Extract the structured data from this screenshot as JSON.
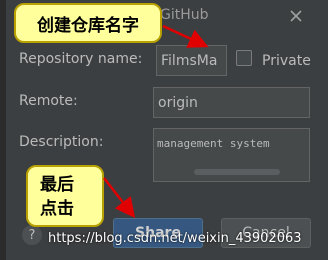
{
  "dialog": {
    "title": "GitHub"
  },
  "form": {
    "repository_label": "Repository name:",
    "repository_value": "FilmsMa",
    "private_label": "Private",
    "remote_label": "Remote:",
    "remote_value": "origin",
    "description_label": "Description:",
    "description_value": "management system"
  },
  "buttons": {
    "help": "?",
    "share": "Share",
    "cancel": "Cancel"
  },
  "annotations": {
    "callout_1": "创建仓库名字",
    "callout_2_line_1": "最后",
    "callout_2_line_2": "点击"
  },
  "watermark": "https://blog.csdn.net/weixin_43902063",
  "icons": {
    "close": "close-icon",
    "help": "help-icon"
  },
  "colors": {
    "background": "#3c3f41",
    "field": "#45494a",
    "share_button": "#365880",
    "callout_fill": "#ffff9c",
    "arrow": "#e00000"
  }
}
